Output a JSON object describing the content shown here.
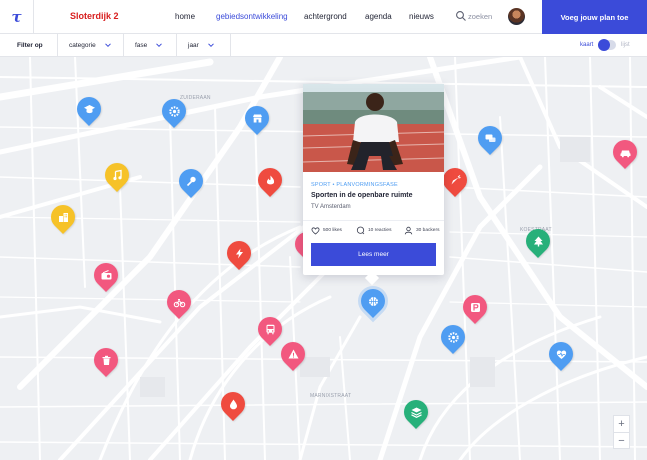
{
  "header": {
    "logo_glyph": "τ",
    "brand": "Sloterdijk 2",
    "nav": [
      "home",
      "gebiedsontwikkeling",
      "achtergrond",
      "agenda",
      "nieuws"
    ],
    "active_nav": "gebiedsontwikkeling",
    "search_placeholder": "zoeken",
    "cta_label": "Voeg jouw plan toe"
  },
  "filters": {
    "label": "Filter op",
    "items": [
      "categorie",
      "fase",
      "jaar"
    ]
  },
  "view_toggle": {
    "left": "kaart",
    "right": "lijst",
    "selected": "kaart"
  },
  "card": {
    "category": "SPORT • PLANVORMINGSFASE",
    "title": "Sporten in de openbare ruimte",
    "organisation": "TV Amsterdam",
    "likes": "500 likes",
    "reactions": "10 reacties",
    "supporters": "30 backers",
    "button": "Lees meer"
  },
  "map_labels": [
    "ZUIDERAAN",
    "KOESTRAAT",
    "MARNIXSTRAAT"
  ],
  "colors": {
    "primary": "#3b4bd9",
    "brand_red": "#d81e1e",
    "pin_blue": "#4f9df2",
    "pin_pink": "#f2587f",
    "pin_red": "#ef4b3f",
    "pin_yellow": "#f6c228",
    "pin_green": "#27b07a"
  },
  "pins": [
    {
      "icon": "graduation-icon",
      "color": "#4f9df2"
    },
    {
      "icon": "gear-icon",
      "color": "#4f9df2"
    },
    {
      "icon": "shop-icon",
      "color": "#4f9df2"
    },
    {
      "icon": "chat-icon",
      "color": "#4f9df2"
    },
    {
      "icon": "car-icon",
      "color": "#f2587f"
    },
    {
      "icon": "music-icon",
      "color": "#f6c228"
    },
    {
      "icon": "microphone-icon",
      "color": "#4f9df2"
    },
    {
      "icon": "fire-icon",
      "color": "#ef4b3f"
    },
    {
      "icon": "carrot-icon",
      "color": "#ef4b3f"
    },
    {
      "icon": "building-icon",
      "color": "#f6c228"
    },
    {
      "icon": "lightning-icon",
      "color": "#ef4b3f"
    },
    {
      "icon": "tree-icon",
      "color": "#27b07a"
    },
    {
      "icon": "radio-icon",
      "color": "#f2587f"
    },
    {
      "icon": "bicycle-icon",
      "color": "#f2587f"
    },
    {
      "icon": "basketball-icon",
      "color": "#4f9df2"
    },
    {
      "icon": "parking-icon",
      "color": "#f2587f"
    },
    {
      "icon": "bus-icon",
      "color": "#f2587f"
    },
    {
      "icon": "warning-icon",
      "color": "#f2587f"
    },
    {
      "icon": "settings-icon",
      "color": "#4f9df2"
    },
    {
      "icon": "heart-icon",
      "color": "#4f9df2"
    },
    {
      "icon": "trash-icon",
      "color": "#f2587f"
    },
    {
      "icon": "drop-icon",
      "color": "#ef4b3f"
    },
    {
      "icon": "layers-icon",
      "color": "#27b07a"
    },
    {
      "icon": "cart-icon",
      "color": "#f2587f"
    }
  ],
  "zoom": {
    "in": "+",
    "out": "−"
  }
}
